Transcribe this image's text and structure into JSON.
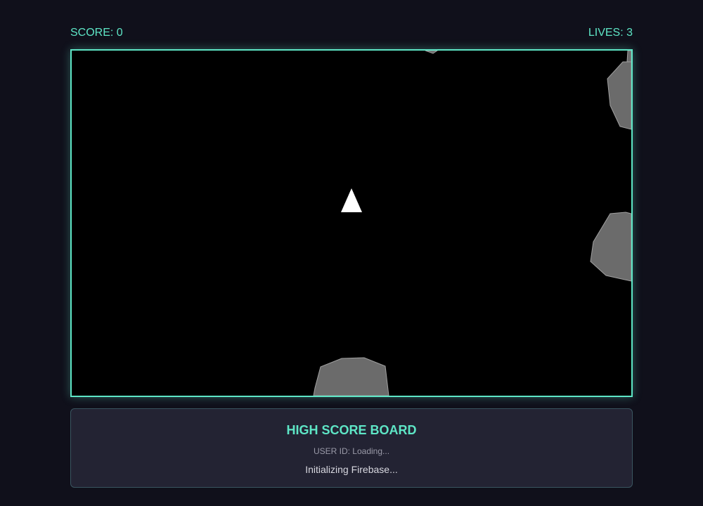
{
  "hud": {
    "score_label": "SCORE: 0",
    "lives_label": "LIVES: 3"
  },
  "game": {
    "ship": "player-ship-triangle",
    "asteroid_count": 5
  },
  "scoreboard": {
    "title": "HIGH SCORE BOARD",
    "user_id": "USER ID: Loading...",
    "status": "Initializing Firebase..."
  },
  "colors": {
    "background": "#10101b",
    "accent": "#5ee6c6",
    "canvas": "#000000",
    "asteroid_fill": "#6b6b6b",
    "asteroid_stroke": "#a0a0a0",
    "ship": "#ffffff",
    "panel": "#232333"
  }
}
